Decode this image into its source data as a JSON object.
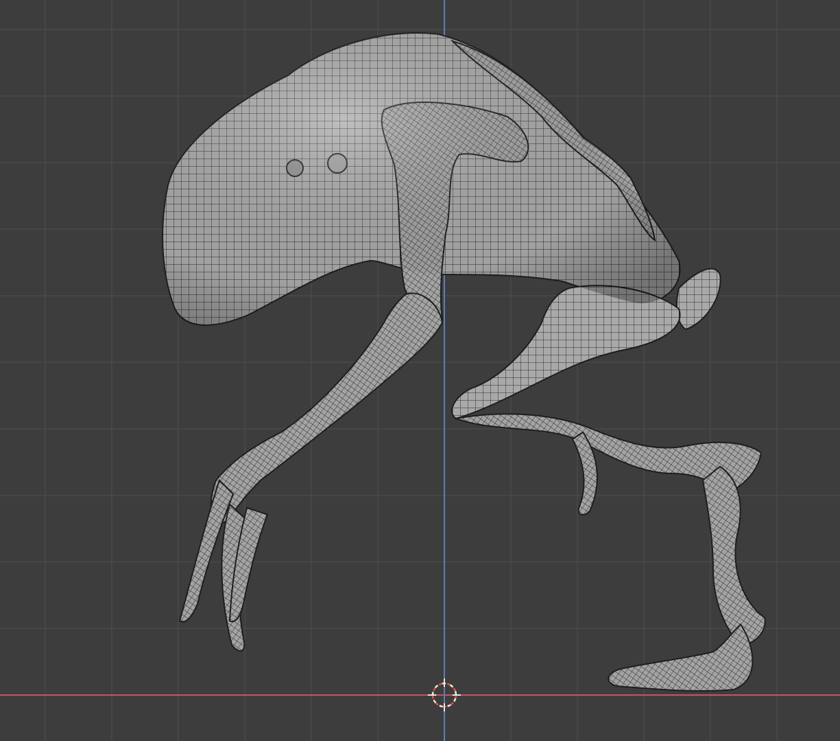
{
  "viewport": {
    "background_color": "#3d3d3d",
    "grid_color": "#4a4a4a",
    "x_axis_color": "#c8555b",
    "z_axis_color": "#5b7fb8",
    "mesh_fill_color": "#a9a9a9",
    "mesh_wire_color": "#2a2a2a",
    "cursor_primary_color": "#e8e8e8",
    "cursor_secondary_color": "#e0533a"
  },
  "scene": {
    "object_icon": "creature-mesh",
    "cursor_icon": "3d-cursor-icon"
  }
}
